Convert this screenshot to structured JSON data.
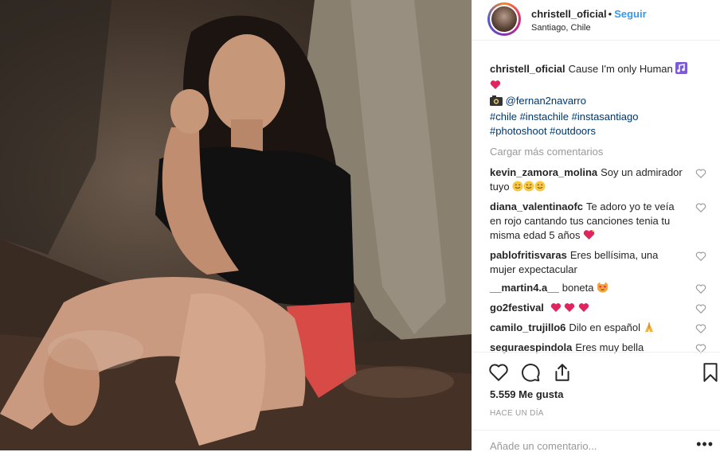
{
  "post": {
    "author": "christell_oficial",
    "follow_label": "Seguir",
    "location": "Santiago, Chile",
    "caption_user": "christell_oficial",
    "caption_line1": "Cause I'm only Human",
    "photo_credit": "@fernan2navarro",
    "hashtags_line1": "#chile #instachile #instasantiago",
    "hashtags_line2": "#photoshoot #outdoors",
    "load_more": "Cargar más comentarios",
    "likes": "5.559 Me gusta",
    "time": "HACE UN DÍA",
    "add_comment_placeholder": "Añade un comentario...",
    "more_dots": "•••"
  },
  "comments": [
    {
      "user": "kevin_zamora_molina",
      "text": "Soy un admirador tuyo"
    },
    {
      "user": "diana_valentinaofc",
      "text": "Te adoro yo te veía en rojo cantando tus canciones tenia tu misma edad 5 años"
    },
    {
      "user": "pablofritisvaras",
      "text": "Eres bellísima, una mujer expectacular"
    },
    {
      "user": "__martin4.a__",
      "text": "boneta"
    },
    {
      "user": "go2festival",
      "text": ""
    },
    {
      "user": "camilo_trujillo6",
      "text": "Dilo en español"
    },
    {
      "user": "seguraespindola",
      "text": "Eres muy bella"
    }
  ],
  "icons": {
    "like": "heart-outline-icon",
    "comment": "speech-bubble-icon",
    "share": "share-icon",
    "save": "bookmark-icon",
    "comment_like": "small-heart-icon"
  },
  "colors": {
    "follow": "#3897f0",
    "link": "#003569",
    "muted": "#999999",
    "text": "#262626"
  }
}
